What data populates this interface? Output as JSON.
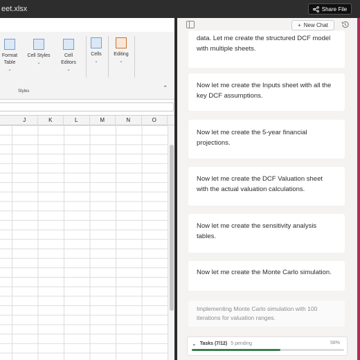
{
  "titlebar": {
    "filename": "eet.xlsx",
    "share_label": "Share File"
  },
  "ribbon": {
    "items": [
      {
        "label": "Format",
        "label2": "Table"
      },
      {
        "label": "Cell Styles"
      },
      {
        "label": "Cell",
        "label2": "Editors"
      },
      {
        "label": "Cells"
      },
      {
        "label": "Editing"
      }
    ],
    "group_label": "Styles"
  },
  "columns": [
    "J",
    "K",
    "L",
    "M",
    "N",
    "O"
  ],
  "chat": {
    "new_chat_label": "New Chat",
    "messages": [
      {
        "l1": "data. Let me create the structured DCF model",
        "l2": "with multiple sheets."
      },
      {
        "l1": "Now let me create the Inputs sheet with all the",
        "l2": "key DCF assumptions."
      },
      {
        "l1": "Now let me create the 5-year financial",
        "l2": "projections."
      },
      {
        "l1": "Now let me create the DCF Valuation sheet",
        "l2": "with the actual valuation calculations."
      },
      {
        "l1": "Now let me create the sensitivity analysis",
        "l2": "tables."
      },
      {
        "l1": "Now let me create the Monte Carlo simulation.",
        "l2": ""
      }
    ],
    "status_message": {
      "l1": "Implementing Monte Carlo simulation with 100",
      "l2": "iterations for valuation ranges."
    },
    "tasks": {
      "title": "Tasks (7/12)",
      "pending": "5 pending",
      "percent_text": "58%",
      "progress_fraction": 0.58
    }
  },
  "colors": {
    "progress": "#3b7f4f",
    "right_edge": "#b52a5e"
  }
}
